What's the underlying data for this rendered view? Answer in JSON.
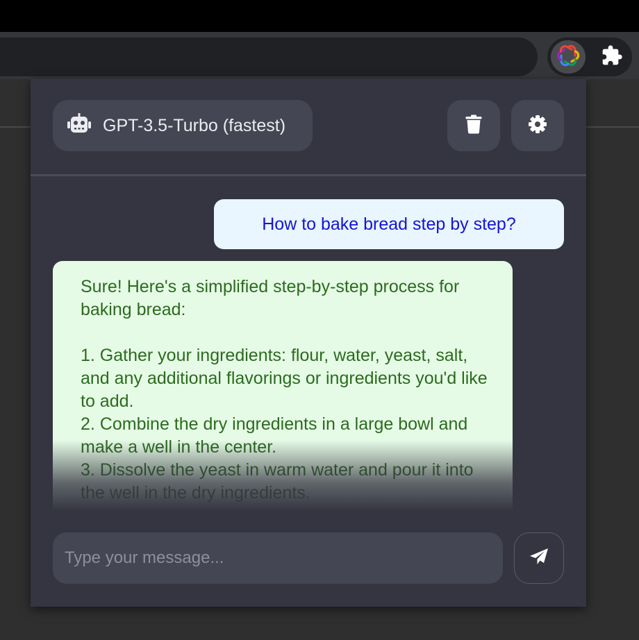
{
  "browser": {
    "extensions": [
      {
        "icon": "openai-logo-icon",
        "active": true
      },
      {
        "icon": "puzzle-icon",
        "active": false
      }
    ]
  },
  "header": {
    "model_icon": "robot-icon",
    "model_label": "GPT-3.5-Turbo (fastest)",
    "clear_icon": "trash-icon",
    "settings_icon": "gear-icon"
  },
  "messages": [
    {
      "role": "user",
      "text": "How to bake bread step by step?"
    },
    {
      "role": "assistant",
      "text": "Sure! Here's a simplified step-by-step process for baking bread:\n\n1. Gather your ingredients: flour, water, yeast, salt, and any additional flavorings or ingredients you'd like to add.\n2. Combine the dry ingredients in a large bowl and make a well in the center.\n3. Dissolve the yeast in warm water and pour it into the well in the dry ingredients."
    }
  ],
  "composer": {
    "placeholder": "Type your message...",
    "value": "",
    "send_icon": "paper-plane-icon"
  },
  "colors": {
    "popup_bg": "#343541",
    "control_bg": "#444653",
    "user_bubble_bg": "#e9f5ff",
    "user_text": "#1414d6",
    "assistant_bubble_bg": "#e6fbe6",
    "assistant_text": "#2b6b1f"
  }
}
